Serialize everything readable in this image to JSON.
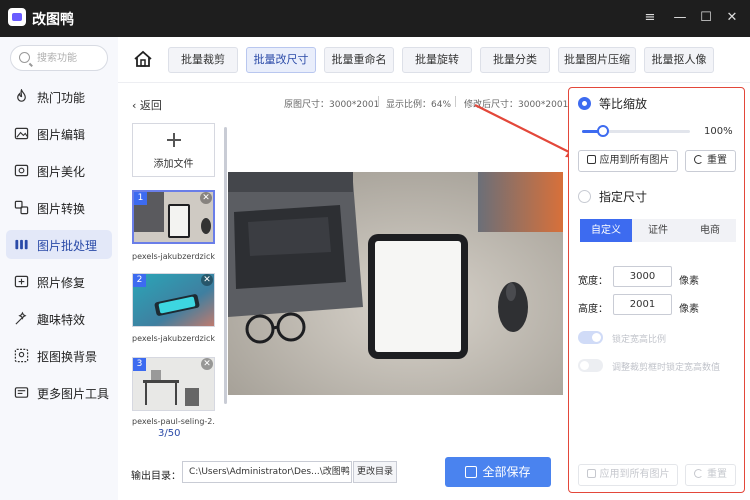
{
  "app": {
    "title": "改图鸭"
  },
  "window_controls": {
    "menu": "≡",
    "minimize": "—",
    "maximize": "☐",
    "close": "✕"
  },
  "search": {
    "placeholder": "搜索功能"
  },
  "sidebar": {
    "items": [
      {
        "label": "热门功能",
        "icon": "flame-icon"
      },
      {
        "label": "图片编辑",
        "icon": "image-edit-icon"
      },
      {
        "label": "图片美化",
        "icon": "beautify-icon"
      },
      {
        "label": "图片转换",
        "icon": "convert-icon"
      },
      {
        "label": "图片批处理",
        "icon": "batch-icon",
        "active": true
      },
      {
        "label": "照片修复",
        "icon": "photo-repair-icon"
      },
      {
        "label": "趣味特效",
        "icon": "effects-icon"
      },
      {
        "label": "抠图换背景",
        "icon": "cutout-icon"
      },
      {
        "label": "更多图片工具",
        "icon": "tools-icon"
      }
    ]
  },
  "tabs": [
    {
      "label": "批量裁剪"
    },
    {
      "label": "批量改尺寸",
      "active": true
    },
    {
      "label": "批量重命名"
    },
    {
      "label": "批量旋转"
    },
    {
      "label": "批量分类"
    },
    {
      "label": "批量图片压缩"
    },
    {
      "label": "批量抠人像"
    }
  ],
  "toolbar": {
    "back": "返回",
    "original_size": "原图尺寸：3000*2001",
    "display_ratio": "显示比例：64%",
    "modified_size": "修改后尺寸：3000*2001"
  },
  "file_list": {
    "add_label": "添加文件",
    "files": [
      {
        "number": "1",
        "name": "pexels-jakubzerdzick..."
      },
      {
        "number": "2",
        "name": "pexels-jakubzerdzick..."
      },
      {
        "number": "3",
        "name": "pexels-paul-seling-2..."
      }
    ],
    "counter": "3/50"
  },
  "output": {
    "label": "输出目录：",
    "path": "C:\\Users\\Administrator\\Des...\\改图鸭",
    "change_button": "更改目录",
    "save_all_button": "全部保存"
  },
  "panel": {
    "proportional_label": "等比缩放",
    "scale_percent": 100,
    "scale_text": "100%",
    "apply_all": "应用到所有图片",
    "reset": "重置",
    "specify_label": "指定尺寸",
    "segments": [
      {
        "label": "自定义",
        "active": true
      },
      {
        "label": "证件"
      },
      {
        "label": "电商"
      }
    ],
    "width_label": "宽度：",
    "width_value": "3000",
    "height_label": "高度：",
    "height_value": "2001",
    "unit": "像素",
    "lock_ratio": "锁定宽高比例",
    "crop_lock": "调整裁剪框时锁定宽高数值",
    "apply_all_bottom": "应用到所有图片",
    "reset_bottom": "重置"
  },
  "colors": {
    "accent": "#3d6bf0",
    "highlight_border": "#e3473a",
    "annotation_arrow": "#e3473a"
  }
}
